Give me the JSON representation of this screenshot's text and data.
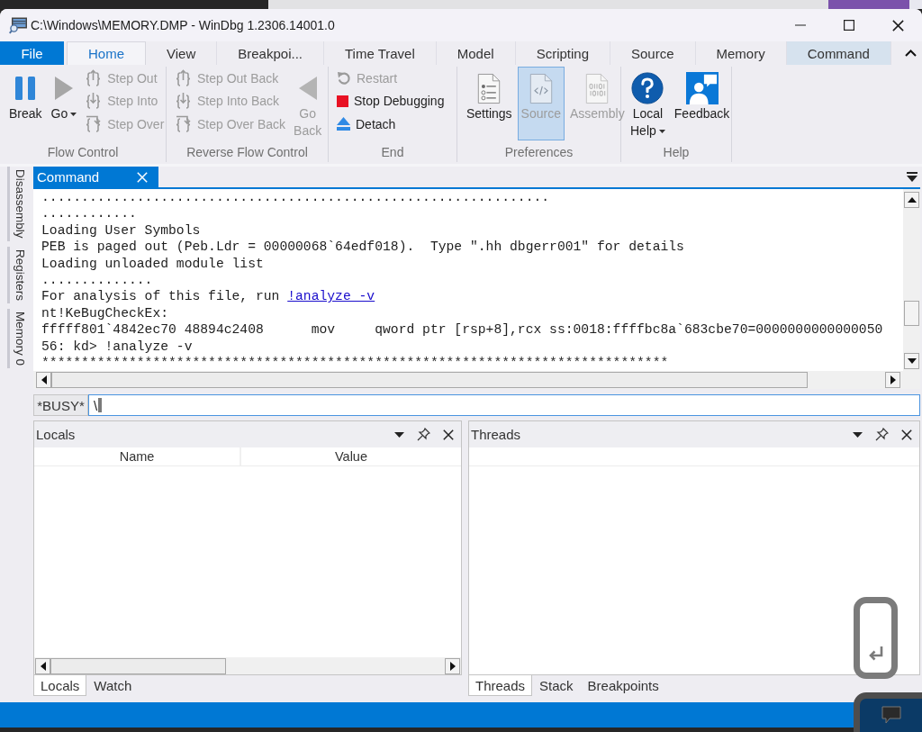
{
  "window": {
    "title": "C:\\Windows\\MEMORY.DMP - WinDbg 1.2306.14001.0"
  },
  "ribbon_tabs": [
    {
      "label": "File",
      "kind": "file",
      "selected": false,
      "highlighted": false
    },
    {
      "label": "Home",
      "kind": "tab",
      "selected": true,
      "highlighted": false
    },
    {
      "label": "View",
      "kind": "tab",
      "selected": false,
      "highlighted": false
    },
    {
      "label": "Breakpoi...",
      "kind": "tab",
      "selected": false,
      "highlighted": false
    },
    {
      "label": "Time Travel",
      "kind": "tab",
      "selected": false,
      "highlighted": false
    },
    {
      "label": "Model",
      "kind": "tab",
      "selected": false,
      "highlighted": false
    },
    {
      "label": "Scripting",
      "kind": "tab",
      "selected": false,
      "highlighted": false
    },
    {
      "label": "Source",
      "kind": "tab",
      "selected": false,
      "highlighted": false
    },
    {
      "label": "Memory",
      "kind": "tab",
      "selected": false,
      "highlighted": false
    },
    {
      "label": "Command",
      "kind": "tab",
      "selected": false,
      "highlighted": true
    }
  ],
  "ribbon_groups": [
    {
      "label": "Flow Control",
      "items": [
        {
          "label": "Break",
          "kind": "large",
          "disabled": false,
          "dropdown": false
        },
        {
          "label": "Go",
          "kind": "large",
          "disabled": false,
          "dropdown": true
        },
        {
          "label": "Step Out",
          "kind": "small",
          "disabled": true,
          "dropdown": false
        },
        {
          "label": "Step Into",
          "kind": "small",
          "disabled": true,
          "dropdown": false
        },
        {
          "label": "Step Over",
          "kind": "small",
          "disabled": true,
          "dropdown": false
        }
      ]
    },
    {
      "label": "Reverse Flow Control",
      "items": [
        {
          "label": "Step Out Back",
          "kind": "small",
          "disabled": true,
          "dropdown": false
        },
        {
          "label": "Step Into Back",
          "kind": "small",
          "disabled": true,
          "dropdown": false
        },
        {
          "label": "Step Over Back",
          "kind": "small",
          "disabled": true,
          "dropdown": false
        },
        {
          "label": "Go Back",
          "kind": "large",
          "disabled": true,
          "dropdown": false
        }
      ]
    },
    {
      "label": "End",
      "items": [
        {
          "label": "Restart",
          "kind": "small",
          "disabled": true,
          "dropdown": false
        },
        {
          "label": "Stop Debugging",
          "kind": "small",
          "disabled": false,
          "dropdown": false
        },
        {
          "label": "Detach",
          "kind": "small",
          "disabled": false,
          "dropdown": false
        }
      ]
    },
    {
      "label": "Preferences",
      "items": [
        {
          "label": "Settings",
          "kind": "large",
          "disabled": false,
          "dropdown": false,
          "selected": false
        },
        {
          "label": "Source",
          "kind": "large",
          "disabled": true,
          "dropdown": false,
          "selected": true
        },
        {
          "label": "Assembly",
          "kind": "large",
          "disabled": true,
          "dropdown": false,
          "selected": false
        }
      ]
    },
    {
      "label": "Help",
      "items": [
        {
          "label": "Local Help",
          "kind": "large",
          "disabled": false,
          "dropdown": true
        },
        {
          "label": "Feedback",
          "kind": "large",
          "disabled": false,
          "dropdown": false
        }
      ]
    }
  ],
  "side_tabs": [
    {
      "label": "Disassembly"
    },
    {
      "label": "Registers"
    },
    {
      "label": "Memory 0"
    }
  ],
  "command_window": {
    "tab": "Command",
    "lines": [
      {
        "text": "................................................................"
      },
      {
        "text": "............"
      },
      {
        "text": "Loading User Symbols"
      },
      {
        "text": "PEB is paged out (Peb.Ldr = 00000068`64edf018).  Type \".hh dbgerr001\" for details"
      },
      {
        "text": "Loading unloaded module list"
      },
      {
        "text": ".............."
      },
      {
        "text": "For analysis of this file, run ",
        "link": "!analyze -v"
      },
      {
        "text": "nt!KeBugCheckEx:"
      },
      {
        "text": "fffff801`4842ec70 48894c2408      mov     qword ptr [rsp+8],rcx ss:0018:ffffbc8a`683cbe70=0000000000000050"
      },
      {
        "text": "56: kd> !analyze -v"
      },
      {
        "text": "*******************************************************************************"
      }
    ],
    "prompt": "*BUSY*",
    "input": {
      "value": "\\"
    }
  },
  "panels": [
    {
      "title": "Locals",
      "kind": "table",
      "columns": [
        "Name",
        "Value"
      ],
      "tabs": [
        {
          "label": "Locals",
          "selected": true
        },
        {
          "label": "Watch",
          "selected": false
        }
      ]
    },
    {
      "title": "Threads",
      "kind": "list",
      "tabs": [
        {
          "label": "Threads",
          "selected": true
        },
        {
          "label": "Stack",
          "selected": false
        },
        {
          "label": "Breakpoints",
          "selected": false
        }
      ]
    }
  ]
}
